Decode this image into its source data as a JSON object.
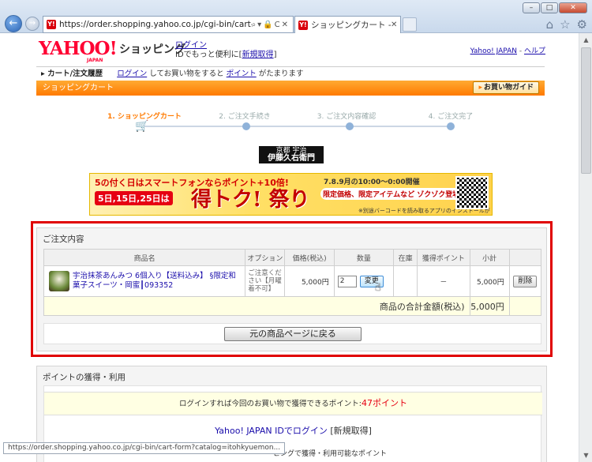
{
  "browser": {
    "url": "https://order.shopping.yahoo.co.jp/cgi-bin/cart-form?catalog",
    "tab_title": "ショッピングカート - Ya...",
    "favicon_label": "Y!",
    "status_url": "https://order.shopping.yahoo.co.jp/cgi-bin/cart-form?catalog=itohkyuemon..."
  },
  "header": {
    "logo": "YAHOO!",
    "logo_sub": "JAPAN",
    "shop_title": "ショッピング",
    "login_link": "ログイン",
    "login_note_prefix": "IDでもっと便利に[",
    "register_link": "新規取得",
    "login_note_suffix": "]",
    "yahoo_japan_link": "Yahoo! JAPAN",
    "sep": " - ",
    "help_link": "ヘルプ"
  },
  "subnav": {
    "history": "カート/注文履歴",
    "login": "ログイン",
    "note": "してお買い物をすると",
    "points": "ポイント",
    "note2": "がたまります"
  },
  "cartbar": {
    "title": "ショッピングカート",
    "guide_button": "お買い物ガイド"
  },
  "steps": [
    "1. ショッピングカート",
    "2. ご注文手続き",
    "3. ご注文内容確認",
    "4. ご注文完了"
  ],
  "store": {
    "line1": "京都 宇治",
    "line2": "伊藤久右衛門"
  },
  "banner": {
    "headline": "5の付く日はスマートフォンならポイント+10倍!",
    "dates": "5日,15日,25日は",
    "title": "得トク! 祭り",
    "time": "7.8.9月の10:00〜0:00開催",
    "limited": "限定価格、限定アイテムなど ゾクゾク登場!",
    "note": "※別途バーコードを読み取るアプリのインストールが必要です"
  },
  "order": {
    "title": "ご注文内容",
    "columns": [
      "商品名",
      "オプション",
      "価格(税込)",
      "数量",
      "在庫",
      "獲得ポイント",
      "小計",
      ""
    ],
    "item": {
      "name": "宇治抹茶あんみつ 6個入り【送料込み】 §限定和菓子スイーツ・岡蜜┃093352",
      "option": "ご注意ください【月曜着不可】",
      "price": "5,000円",
      "quantity": "2",
      "change_button": "変更",
      "stock": "",
      "points": "－",
      "subtotal": "5,000円",
      "delete_button": "削除"
    },
    "total_label": "商品の合計金額(税込)",
    "total_value": "5,000円",
    "back_button": "元の商品ページに戻る"
  },
  "points": {
    "title": "ポイントの獲得・利用",
    "note": "ログインすれば今回のお買い物で獲得できるポイント:",
    "points_value": "47ポイント",
    "id_login": "Yahoo! JAPAN IDでログイン",
    "register": "[新規取得]",
    "sub": "ピングで獲得・利用可能なポイント"
  }
}
